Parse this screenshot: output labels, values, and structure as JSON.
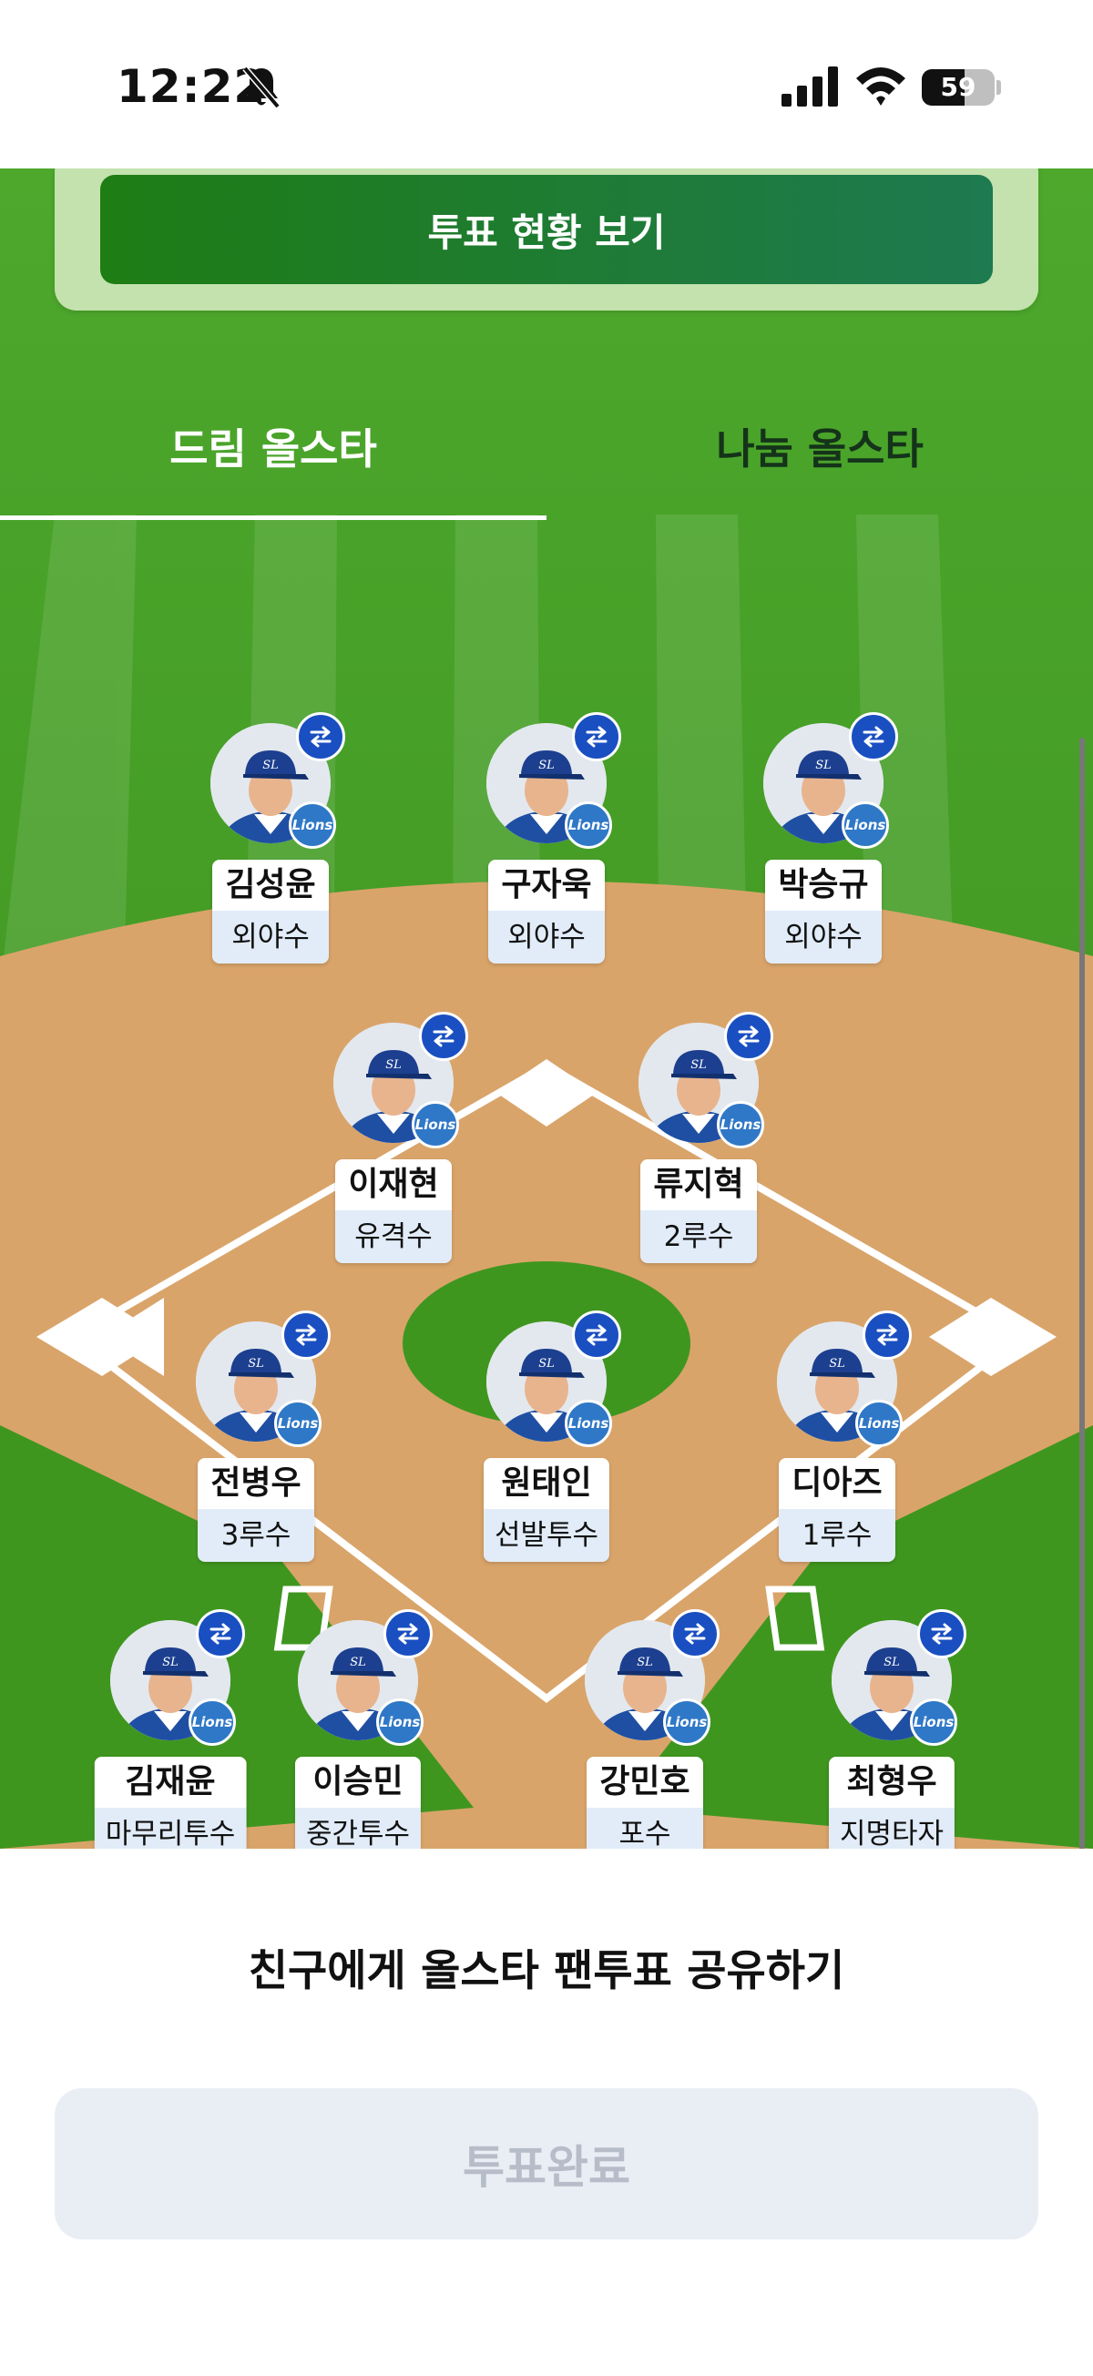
{
  "status": {
    "time": "12:22",
    "battery": "59",
    "battery_level": 0.59
  },
  "vote_status_button": "투표 현황 보기",
  "tabs": [
    {
      "label": "드림 올스타",
      "active": true
    },
    {
      "label": "나눔 올스타",
      "active": false
    }
  ],
  "team_logo_text": "Lions",
  "players": [
    {
      "name": "김성윤",
      "position": "외야수"
    },
    {
      "name": "구자욱",
      "position": "외야수"
    },
    {
      "name": "박승규",
      "position": "외야수"
    },
    {
      "name": "이재현",
      "position": "유격수"
    },
    {
      "name": "류지혁",
      "position": "2루수"
    },
    {
      "name": "전병우",
      "position": "3루수"
    },
    {
      "name": "원태인",
      "position": "선발투수"
    },
    {
      "name": "디아즈",
      "position": "1루수"
    },
    {
      "name": "김재윤",
      "position": "마무리투수"
    },
    {
      "name": "이승민",
      "position": "중간투수"
    },
    {
      "name": "강민호",
      "position": "포수"
    },
    {
      "name": "최형우",
      "position": "지명타자"
    }
  ],
  "share_text": "친구에게 올스타 팬투표 공유하기",
  "complete_button": "투표완료",
  "colors": {
    "primary_green": "#1e7d14",
    "swap_blue": "#1a4fc2",
    "infield_dirt": "#d9a46a",
    "disabled_bg": "#e9edf4"
  }
}
